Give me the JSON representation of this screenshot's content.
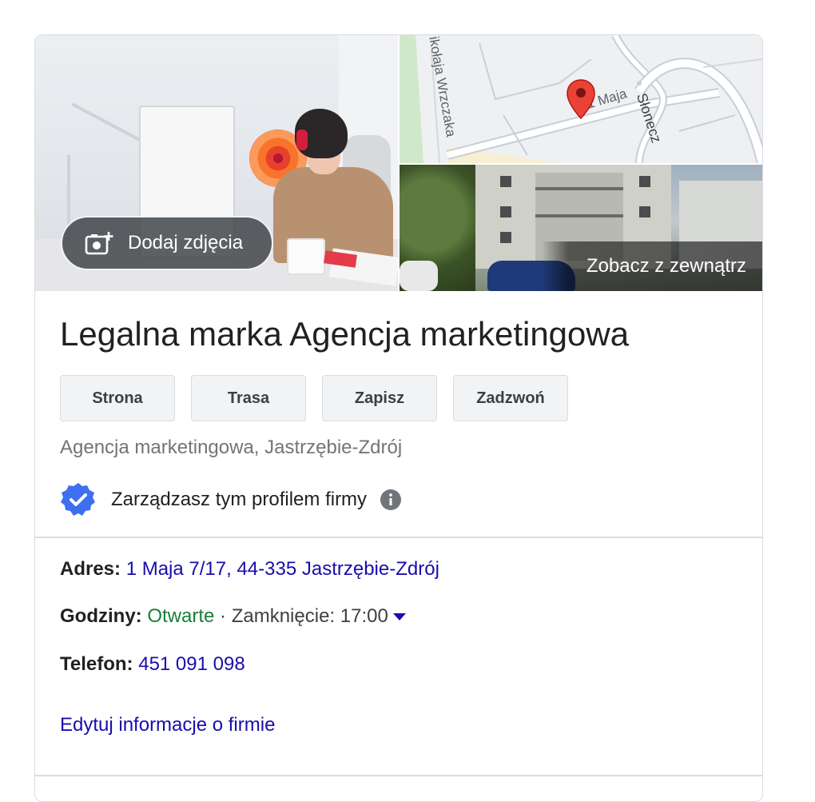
{
  "media": {
    "add_photo_label": "Dodaj zdjęcia",
    "street_view_label": "Zobacz z zewnątrz",
    "map_labels": [
      "ikołaja Wrzczaka",
      "1 Maja",
      "Słonecz"
    ]
  },
  "business": {
    "name": "Legalna marka Agencja marketingowa",
    "category": "Agencja marketingowa, Jastrzębie-Zdrój",
    "verified_text": "Zarządzasz tym profilem firmy"
  },
  "actions": {
    "website": "Strona",
    "directions": "Trasa",
    "save": "Zapisz",
    "call": "Zadzwoń"
  },
  "details": {
    "address_label": "Adres:",
    "address_value": "1 Maja 7/17, 44-335 Jastrzębie-Zdrój",
    "hours_label": "Godziny:",
    "hours_status": "Otwarte",
    "hours_separator": "·",
    "hours_close": "Zamknięcie: 17:00",
    "phone_label": "Telefon:",
    "phone_value": "451 091 098"
  },
  "edit_link": "Edytuj informacje o firmie",
  "colors": {
    "link": "#1a0dab",
    "open": "#188038",
    "badge": "#3d6ff0",
    "pin": "#ea4335"
  }
}
